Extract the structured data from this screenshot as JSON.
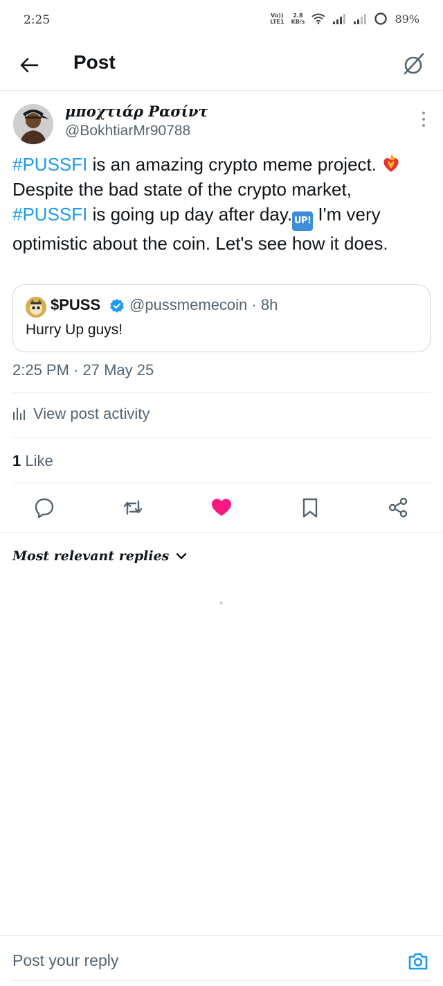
{
  "status_bar": {
    "time": "2:25",
    "volte_top": "Vo))",
    "volte_bottom": "LTE1",
    "speed_top": "2.8",
    "speed_bottom": "KB/s",
    "battery": "89%"
  },
  "header": {
    "title": "Post",
    "back_icon": "arrow-left-icon",
    "grok_icon": "grok-icon"
  },
  "post": {
    "display_name": "μποχτιάρ Ρασίντ",
    "handle": "@BokhtiarMr90788",
    "text": {
      "hashtag_1": "#PUSSFI",
      "part_1": " is an amazing crypto meme project. ",
      "part_2": "Despite the bad state of the crypto market, ",
      "hashtag_2": "#PUSSFI",
      "part_3": " is going up day after day.",
      "up_emoji": "UP!",
      "part_4": " I'm very optimistic about the coin. Let's see how it does."
    },
    "quote": {
      "name": "$PUSS",
      "handle_time": "@pussmemecoin · 8h",
      "text": "Hurry Up guys!"
    },
    "timestamp": "2:25 PM · 27 May 25",
    "activity_label": "View post activity",
    "likes_count": "1",
    "likes_label": " Like"
  },
  "actions": {
    "reply_icon": "reply-icon",
    "repost_icon": "repost-icon",
    "like_icon": "heart-icon",
    "bookmark_icon": "bookmark-icon",
    "share_icon": "share-icon",
    "like_color": "#f91880"
  },
  "replies": {
    "sort_label": "Most relevant replies"
  },
  "reply_bar": {
    "placeholder": "Post your reply",
    "camera_color": "#1d9bf0"
  }
}
